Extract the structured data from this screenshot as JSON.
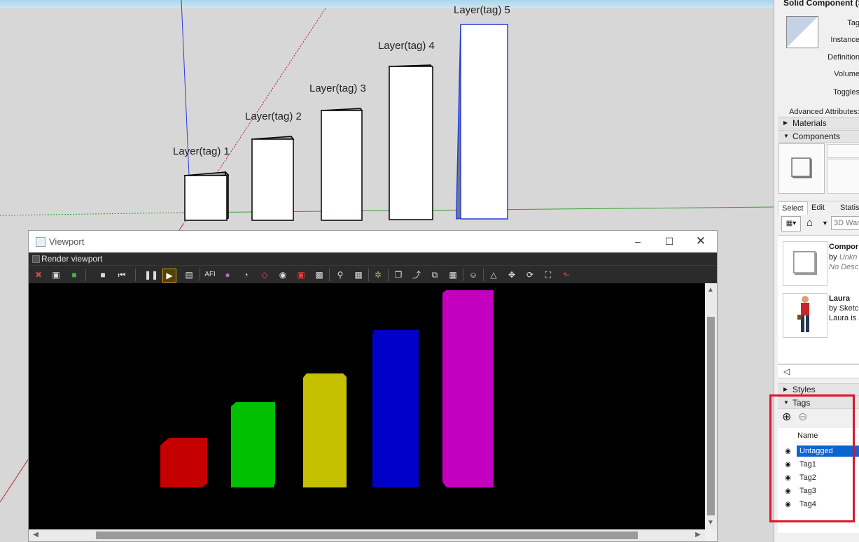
{
  "scene": {
    "tag_labels": [
      "Layer(tag) 1",
      "Layer(tag) 2",
      "Layer(tag) 3",
      "Layer(tag) 4",
      "Layer(tag) 5"
    ]
  },
  "viewport": {
    "title": "Viewport",
    "menu_render": "Render viewport",
    "toolbar_icons": [
      "deadline-icon",
      "region-icon",
      "cube-color-icon",
      "stop-icon",
      "restart-icon",
      "pause-icon",
      "play-icon",
      "viewport-icon",
      "afi-icon",
      "color-wheel-icon",
      "lens-icon",
      "light-icon",
      "camera-icon",
      "bucket-icon",
      "frame-icon",
      "zoom-icon",
      "region-select-icon",
      "settings-icon",
      "copy-icon",
      "export-icon",
      "layers-icon",
      "checker-icon",
      "lock-icon",
      "box-icon",
      "move-icon",
      "rotate-icon",
      "fit-icon",
      "axis-icon"
    ],
    "render_bar_colors": [
      "#c40000",
      "#00c000",
      "#c4c000",
      "#0000c8",
      "#c400c0"
    ]
  },
  "tray": {
    "entity_title": "Solid Component (S",
    "entity_labels": [
      "Tag",
      "Instance",
      "Definition",
      "Volume",
      "Toggles"
    ],
    "advanced_attributes": "Advanced Attributes:",
    "sections": {
      "materials": "Materials",
      "components": "Components",
      "styles": "Styles",
      "tags": "Tags"
    },
    "component_tabs": [
      "Select",
      "Edit",
      "Statis"
    ],
    "search_placeholder": "3D War",
    "components": [
      {
        "title": "Compor",
        "by": "by",
        "author": "Unkn",
        "desc": "No Desc"
      },
      {
        "title": "Laura",
        "by": "by",
        "author": "Sketch",
        "desc": "Laura is a"
      }
    ],
    "tags_header": "Name",
    "tags": [
      "Untagged",
      "Tag1",
      "Tag2",
      "Tag3",
      "Tag4"
    ]
  }
}
